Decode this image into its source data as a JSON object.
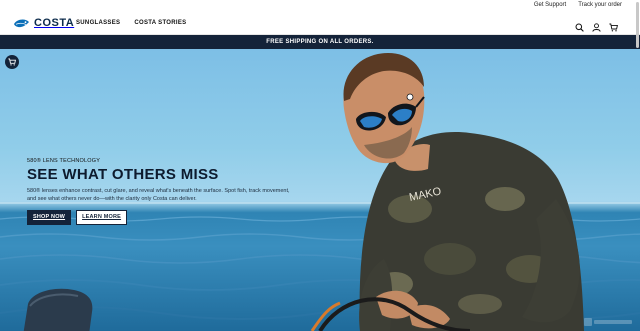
{
  "utility": {
    "support_label": "Get Support",
    "track_label": "Track your order"
  },
  "header": {
    "brand": "COSTA",
    "nav": [
      {
        "label": "SUNGLASSES"
      },
      {
        "label": "COSTA STORIES"
      }
    ],
    "icons": [
      "search-icon",
      "account-icon",
      "cart-icon"
    ]
  },
  "promo": {
    "text": "FREE SHIPPING ON ALL ORDERS."
  },
  "hero": {
    "eyebrow": "580® LENS TECHNOLOGY",
    "headline": "SEE WHAT OTHERS MISS",
    "description": "580® lenses enhance contrast, cut glare, and reveal what's beneath the surface. Spot fish, track movement, and see what others never do—with the clarity only Costa can deliver.",
    "primary_cta": "SHOP NOW",
    "secondary_cta": "LEARN MORE",
    "shirt_text": "MAKO"
  },
  "colors": {
    "navy": "#142339",
    "brand_blue": "#0b6fb8"
  }
}
